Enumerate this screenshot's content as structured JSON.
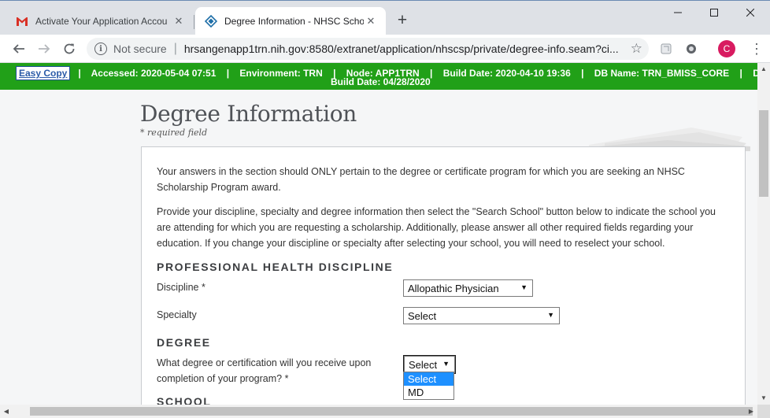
{
  "browser": {
    "tabs": [
      {
        "title": "Activate Your Application Accou",
        "favicon": "gmail-icon",
        "active": false
      },
      {
        "title": "Degree Information - NHSC Scho",
        "favicon": "hrsa-icon",
        "active": true
      }
    ],
    "new_tab_label": "+",
    "security_label": "Not secure",
    "url": "hrsangenapp1trn.nih.gov:8580/extranet/application/nhscsp/private/degree-info.seam?ci...",
    "profile_initial": "C"
  },
  "envbar": {
    "easy_copy": "Easy Copy",
    "line1": "|    Accessed: 2020-05-04 07:51    |    Environment: TRN    |    Node: APP1TRN    |    Build Date: 2020-04-10 19:36    |    DB Name: TRN_BMISS_CORE    |    DB",
    "line2": "Build Date: 04/28/2020"
  },
  "page": {
    "title": "Degree Information",
    "required_note": "* required field"
  },
  "intro": {
    "p1": "Your answers in the section should ONLY pertain to the degree or certificate program for which you are seeking an NHSC Scholarship Program award.",
    "p2": "Provide your discipline, specialty and degree information then select the \"Search School\" button below to indicate the school you are attending for which you are requesting a scholarship. Additionally, please answer all other required fields regarding your education. If you change your discipline or specialty after selecting your school, you will need to reselect your school."
  },
  "discipline_section": {
    "heading": "PROFESSIONAL HEALTH DISCIPLINE",
    "discipline_label": "Discipline *",
    "discipline_value": "Allopathic Physician",
    "specialty_label": "Specialty",
    "specialty_value": "Select"
  },
  "degree_section": {
    "heading": "DEGREE",
    "question": "What degree or certification will you receive upon completion of your program? *",
    "value": "Select",
    "options": [
      "Select",
      "MD"
    ]
  },
  "school_section": {
    "heading": "SCHOOL"
  },
  "colors": {
    "env_green": "#21a018",
    "highlight_blue": "#1e90ff",
    "avatar_pink": "#d81b60"
  }
}
